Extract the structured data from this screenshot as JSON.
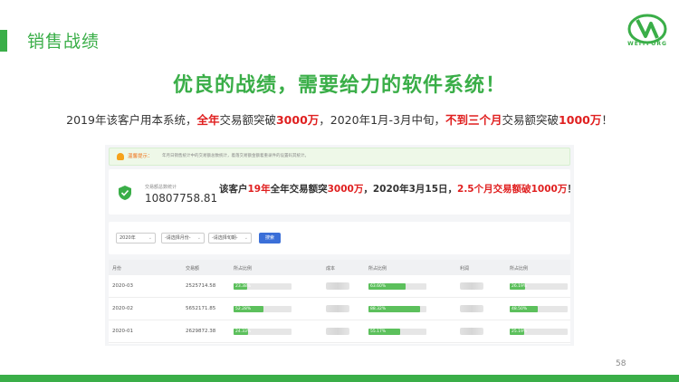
{
  "slide": {
    "title": "销售战绩",
    "logo_text": "WEITFORG",
    "headline": "优良的战绩，需要给力的软件系统！",
    "subline": {
      "p1": "2019年该客户用本系统，",
      "r1": "全年",
      "p2": "交易额突破",
      "r2": "3000万",
      "p3": "，2020年1月-3月中旬，",
      "r3": "不到三个月",
      "p4": "交易额突破",
      "r4": "1000万",
      "p5": "！"
    },
    "page_number": "58"
  },
  "screenshot": {
    "notice": {
      "label": "温馨提示：",
      "text": "年月日销售统计中的交易额总数统计，着落交易额金额着重录件的设置码其统计。"
    },
    "stat": {
      "label": "交易额总数统计",
      "value": "10807758.81",
      "note_p1": "该客户",
      "note_r1": "19年",
      "note_p2": "全年交易额突",
      "note_r2": "3000万",
      "note_p3": "，2020年3月15日，",
      "note_r3": "2.5个月交易额破1000万",
      "note_p4": "！"
    },
    "filters": {
      "year": "2020年",
      "month": "-请选择月份-",
      "period": "-请选择旬期-",
      "search": "搜索"
    },
    "table": {
      "headers": [
        "月份",
        "交易额",
        "所占比例",
        "成本",
        "所占比例",
        "利润",
        "所占比例"
      ],
      "rows": [
        {
          "month": "2020-03",
          "amount": "2525714.58",
          "p1": "23.38%",
          "p1v": 0.2338,
          "p2": "63.60%",
          "p2v": 0.636,
          "p3": "26.19%",
          "p3v": 0.2619
        },
        {
          "month": "2020-02",
          "amount": "5652171.85",
          "p1": "52.28%",
          "p1v": 0.5228,
          "p2": "88.32%",
          "p2v": 0.8832,
          "p3": "48.50%",
          "p3v": 0.485
        },
        {
          "month": "2020-01",
          "amount": "2629872.38",
          "p1": "24.33%",
          "p1v": 0.2433,
          "p2": "55.17%",
          "p2v": 0.5517,
          "p3": "25.19%",
          "p3v": 0.2519
        }
      ]
    }
  },
  "colors": {
    "brand_green": "#3aae48",
    "highlight_red": "#e02020",
    "search_blue": "#3b6fd8"
  }
}
